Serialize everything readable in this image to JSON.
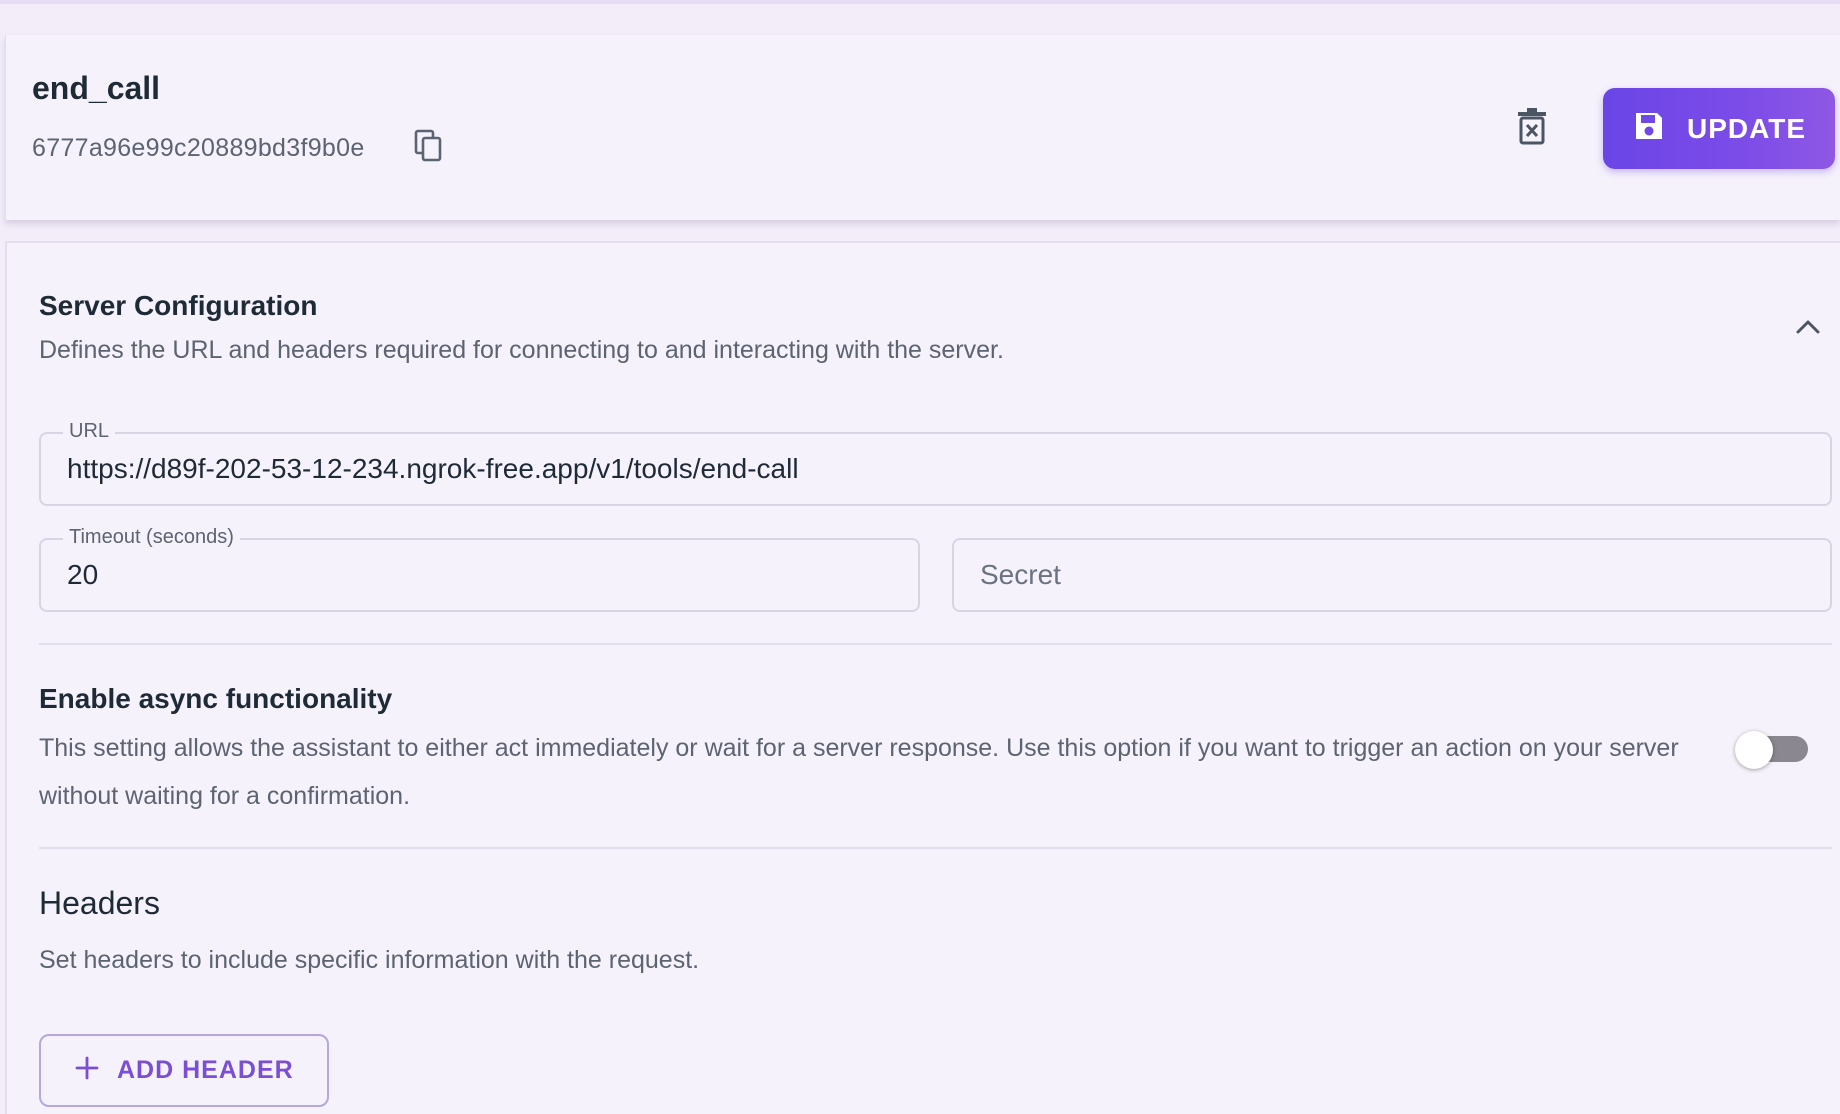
{
  "tool": {
    "name": "end_call",
    "id": "6777a96e99c20889bd3f9b0e"
  },
  "actions": {
    "update_label": "UPDATE"
  },
  "server_config": {
    "title": "Server Configuration",
    "description": "Defines the URL and headers required for connecting to and interacting with the server.",
    "url_label": "URL",
    "url_value": "https://d89f-202-53-12-234.ngrok-free.app/v1/tools/end-call",
    "timeout_label": "Timeout (seconds)",
    "timeout_value": "20",
    "secret_placeholder": "Secret",
    "secret_value": ""
  },
  "async": {
    "title": "Enable async functionality",
    "description": "This setting allows the assistant to either act immediately or wait for a server response. Use this option if you want to trigger an action on your server without waiting for a confirmation.",
    "enabled": false
  },
  "headers": {
    "title": "Headers",
    "description": "Set headers to include specific information with the request.",
    "add_label": "ADD HEADER"
  },
  "colors": {
    "accent": "#7c4ce8",
    "background": "#f6f2fb",
    "text": "#1f2a37",
    "muted": "#5b6470"
  },
  "icons": {
    "copy": "copy-icon",
    "delete": "delete-icon",
    "save": "save-icon",
    "collapse": "chevron-up-icon",
    "add": "plus-icon"
  }
}
